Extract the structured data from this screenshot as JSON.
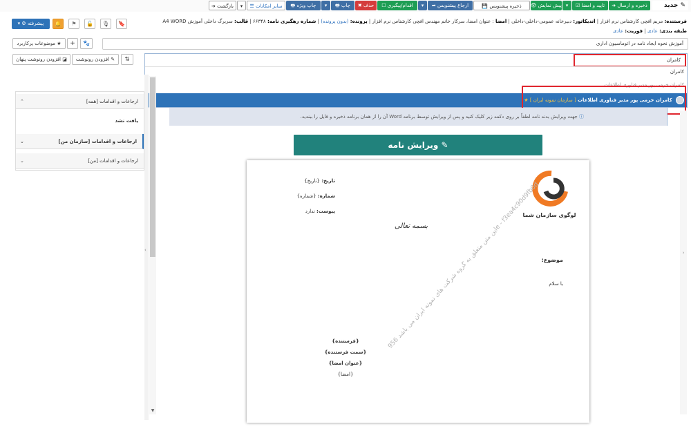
{
  "toolbar": {
    "new_label": "جدید",
    "save_send": "ذخیره و ارسال",
    "approve_sign": "تایید و امضا",
    "preview": "پیش نمایش",
    "save_draft": "ذخیره پیشنویس",
    "return_draft": "ارجاع پیشنویس",
    "action_followup": "اقدام/پیگیری",
    "delete": "حذف",
    "print": "چاپ",
    "special_print": "چاپ ویژه",
    "other_features": "سایر امکانات",
    "back": "بازگشت",
    "advanced": "پیشرفته"
  },
  "meta": {
    "line1": {
      "sender_label": "فرستنده:",
      "sender_value": "مریم افچی کارشناس نرم افزار",
      "indicator_label": "اندیکاتور:",
      "indicator_value": "دبیرخانه عمومی-داخلی-داخلی",
      "sign_label": "امضا",
      "sign_value": "عنوان امضا، سرکار خانم مهندس افچی کارشناس نرم افزار",
      "file_label": "پرونده:",
      "file_value": "(بدون پرونده)",
      "tracking_label": "شماره رهگیری نامه:",
      "tracking_value": "۶۶۳۴۸",
      "template_label": "قالب:",
      "template_value": "سربرگ داخلی آموزش A4 WORD"
    },
    "line2": {
      "class_label": "طبقه بندی:",
      "class_value": "عادی",
      "urgency_label": "فوریت:",
      "urgency_value": "عادی"
    }
  },
  "subject_value": "آموزش نحوه ایجاد نامه در اتوماسیون اداری",
  "frequent_topics": "موضوعات پرکاربرد",
  "add_copy": "افزودن رونوشت",
  "add_hidden_copy": "افزودن رونوشت پنهان",
  "recipient_input": "کامران",
  "autocomplete": {
    "item1": "کامران",
    "item2": "کامران  خرمی پور  مدیر فناوری اطلاعات",
    "item2_org": "[ سازمان نمونه ایران ]",
    "hidden_text": "کامران خرمی پور مدیر فناوری اطلاعات"
  },
  "info_text": "جهت ویرایش بدنه نامه لطفاً بر روی دکمه زیر کلیک کنید و پس از ویرایش توسط برنامه Word آن را از همان برنامه ذخیره و فایل را ببندید.",
  "edit_letter": "ویرایش نامه",
  "sidebar": {
    "items": [
      {
        "label": "ارجاعات و اقدامات [همه]",
        "chev": "⌃"
      },
      {
        "label": "یافت نشد",
        "chev": ""
      },
      {
        "label": "ارجاعات و اقدامات [سازمان من]",
        "chev": "⌄"
      },
      {
        "label": "ارجاعات و اقدامات [من]",
        "chev": "⌄"
      }
    ]
  },
  "letter": {
    "date_label": "تاریخ:",
    "date_value": "{تاریخ}",
    "number_label": "شماره:",
    "number_value": "{شماره}",
    "attach_label": "پیوست:",
    "attach_value": "ندارد",
    "basmala": "بسمه تعالی",
    "logo_text": "لوگوی سازمان شما",
    "subject_label": "موضوع:",
    "greeting": "با سلام",
    "sender": "{فرستنده}",
    "sender_post": "{سمت فرستنده}",
    "sign_title": "{عنوان امضا}",
    "signature": "{امضا}",
    "watermark": "این متن متعلق به گروه شرکت های نمونه ایران می باشد 956e - f3ea4c90d9fb0d67cbc1c790db04edf"
  },
  "colors": {
    "accent_blue": "#2e73b8",
    "highlight_red": "#e0262e",
    "edit_button": "#21827c",
    "save_send": "#1e9e54"
  }
}
